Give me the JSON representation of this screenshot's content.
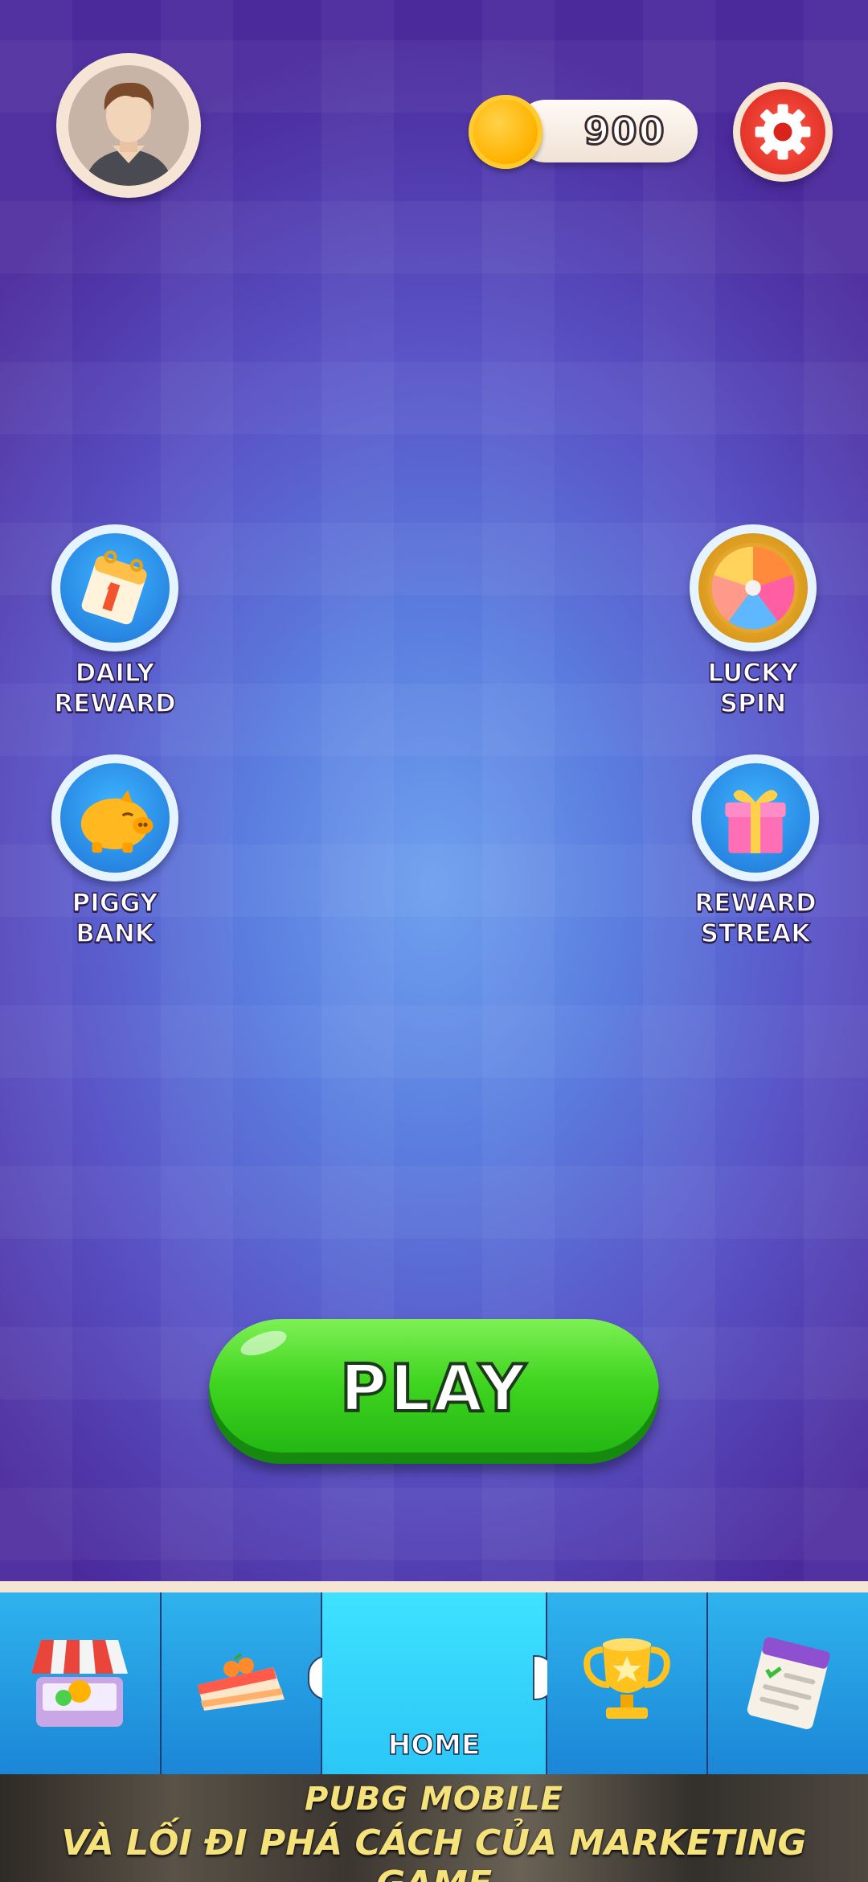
{
  "header": {
    "coins": "900"
  },
  "features": {
    "daily_reward": "DAILY\nREWARD",
    "lucky_spin": "LUCKY\nSPIN",
    "piggy_bank": "PIGGY\nBANK",
    "reward_streak": "REWARD\nSTREAK"
  },
  "play_label": "PLAY",
  "nav": {
    "items": [
      {
        "icon": "shop-icon"
      },
      {
        "icon": "cake-icon"
      },
      {
        "icon": "home",
        "label": "HOME"
      },
      {
        "icon": "trophy-icon"
      },
      {
        "icon": "tasks-icon"
      }
    ]
  },
  "banner": {
    "title": "PUBG MOBILE",
    "subtitle": "VÀ LỐI ĐI PHÁ CÁCH CỦA MARKETING GAME"
  },
  "colors": {
    "coin": "#ffb300",
    "play_button": "#3fd41f",
    "settings": "#d9241b",
    "nav_active": "#3ee2ff"
  }
}
